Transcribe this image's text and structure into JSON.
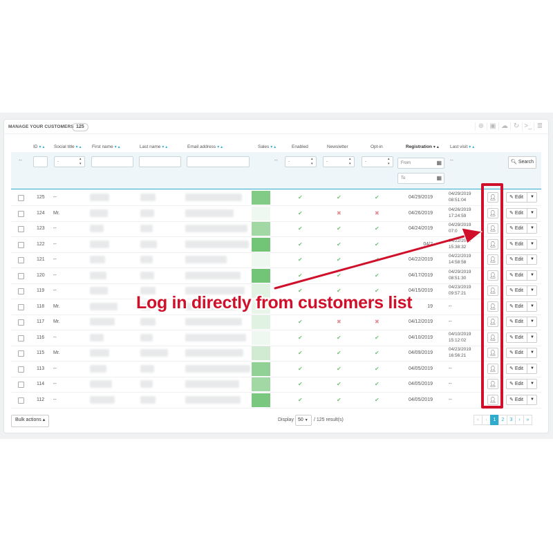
{
  "panel": {
    "title": "MANAGE YOUR CUSTOMERS",
    "count": "125"
  },
  "toolbar_icons": [
    "add-icon",
    "export-icon",
    "import-icon",
    "refresh-icon",
    "sql-icon",
    "database-icon"
  ],
  "columns": {
    "id": "ID",
    "social_title": "Social title",
    "first_name": "First name",
    "last_name": "Last name",
    "email": "Email address",
    "sales": "Sales",
    "enabled": "Enabled",
    "newsletter": "Newsletter",
    "optin": "Opt-in",
    "registration": "Registration",
    "last_visit": "Last visit"
  },
  "filters": {
    "id_dash": "--",
    "select_value": "-",
    "sales_dash": "--",
    "last_visit_dash": "--",
    "from_placeholder": "From",
    "to_placeholder": "To",
    "search_label": "Search"
  },
  "rows": [
    {
      "id": "125",
      "title": "--",
      "enabled": "yes",
      "newsletter": "yes",
      "optin": "yes",
      "registration": "04/29/2019",
      "last_visit": [
        "04/29/2019",
        "08:51:04"
      ]
    },
    {
      "id": "124",
      "title": "Mr.",
      "enabled": "yes",
      "newsletter": "no",
      "optin": "no",
      "registration": "04/26/2019",
      "last_visit": [
        "04/26/2019",
        "17:24:59"
      ]
    },
    {
      "id": "123",
      "title": "--",
      "enabled": "yes",
      "newsletter": "yes",
      "optin": "yes",
      "registration": "04/24/2019",
      "last_visit": [
        "04/29/2019",
        "07:0"
      ]
    },
    {
      "id": "122",
      "title": "--",
      "enabled": "yes",
      "newsletter": "yes",
      "optin": "yes",
      "registration": "04/2",
      "last_visit": [
        "04/22/2019",
        "15:38:32"
      ]
    },
    {
      "id": "121",
      "title": "--",
      "enabled": "yes",
      "newsletter": "yes",
      "optin": "yes",
      "registration": "04/22/2019",
      "last_visit": [
        "04/22/2019",
        "14:58:58"
      ]
    },
    {
      "id": "120",
      "title": "--",
      "enabled": "yes",
      "newsletter": "yes",
      "optin": "yes",
      "registration": "04/17/2019",
      "last_visit": [
        "04/29/2019",
        "08:51:30"
      ]
    },
    {
      "id": "119",
      "title": "--",
      "enabled": "yes",
      "newsletter": "yes",
      "optin": "yes",
      "registration": "04/15/2019",
      "last_visit": [
        "04/23/2019",
        "09:57:21"
      ]
    },
    {
      "id": "118",
      "title": "Mr.",
      "enabled": "yes",
      "newsletter": "yes",
      "optin": "yes",
      "registration": "19",
      "last_visit": [
        "--"
      ]
    },
    {
      "id": "117",
      "title": "Mr.",
      "enabled": "yes",
      "newsletter": "no",
      "optin": "no",
      "registration": "04/12/2019",
      "last_visit": [
        "--"
      ]
    },
    {
      "id": "116",
      "title": "--",
      "enabled": "yes",
      "newsletter": "yes",
      "optin": "yes",
      "registration": "04/10/2019",
      "last_visit": [
        "04/10/2019",
        "15:12:02"
      ]
    },
    {
      "id": "115",
      "title": "Mr.",
      "enabled": "yes",
      "newsletter": "yes",
      "optin": "yes",
      "registration": "04/09/2019",
      "last_visit": [
        "04/23/2019",
        "16:56:21"
      ]
    },
    {
      "id": "113",
      "title": "--",
      "enabled": "yes",
      "newsletter": "yes",
      "optin": "yes",
      "registration": "04/05/2019",
      "last_visit": [
        "--"
      ]
    },
    {
      "id": "114",
      "title": "--",
      "enabled": "yes",
      "newsletter": "yes",
      "optin": "yes",
      "registration": "04/05/2019",
      "last_visit": [
        "--"
      ]
    },
    {
      "id": "112",
      "title": "--",
      "enabled": "yes",
      "newsletter": "yes",
      "optin": "yes",
      "registration": "04/05/2019",
      "last_visit": [
        "--"
      ]
    }
  ],
  "row_actions": {
    "edit_label": "Edit",
    "login_icon": "user-icon"
  },
  "footer": {
    "bulk_actions": "Bulk actions",
    "display_label": "Display",
    "per_page": "50",
    "results": "/ 125 result(s)",
    "pages": [
      "«",
      "‹",
      "1",
      "2",
      "3",
      "›",
      "»"
    ],
    "current_page": "1"
  },
  "annotation": {
    "text": "Log in directly from customers list",
    "color": "#d0102a"
  }
}
